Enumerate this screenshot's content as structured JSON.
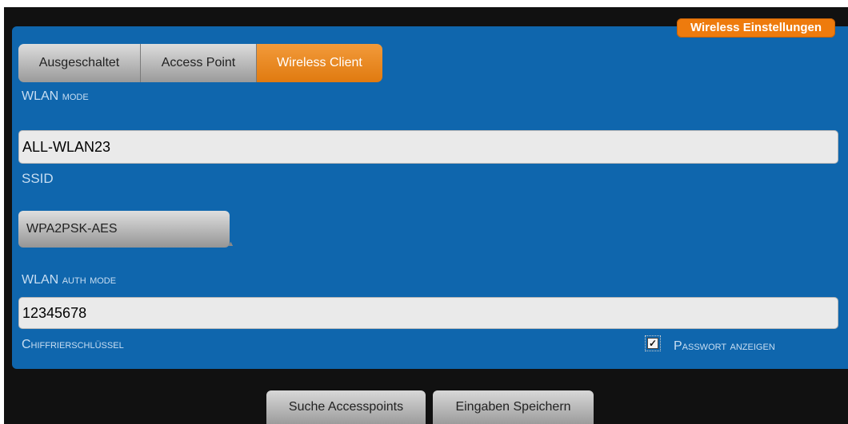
{
  "badge": "Wireless Einstellungen",
  "wlan_mode": {
    "options": [
      "Ausgeschaltet",
      "Access Point",
      "Wireless Client"
    ],
    "selected": "Wireless Client",
    "label_prefix": "WLAN",
    "label_suffix": "mode"
  },
  "ssid": {
    "value": "ALL-WLAN23",
    "label": "SSID"
  },
  "auth": {
    "selected": "WPA2PSK-AES",
    "label_prefix": "WLAN",
    "label_suffix": "auth mode"
  },
  "key": {
    "value": "12345678",
    "label": "Chiffrierschlüssel"
  },
  "show_password": {
    "checked": true,
    "label": "Passwort anzeigen"
  },
  "buttons": {
    "search": "Suche Accesspoints",
    "save": "Eingaben Speichern"
  },
  "colors": {
    "panel": "#0f66ad",
    "accent": "#ee7b0d"
  }
}
